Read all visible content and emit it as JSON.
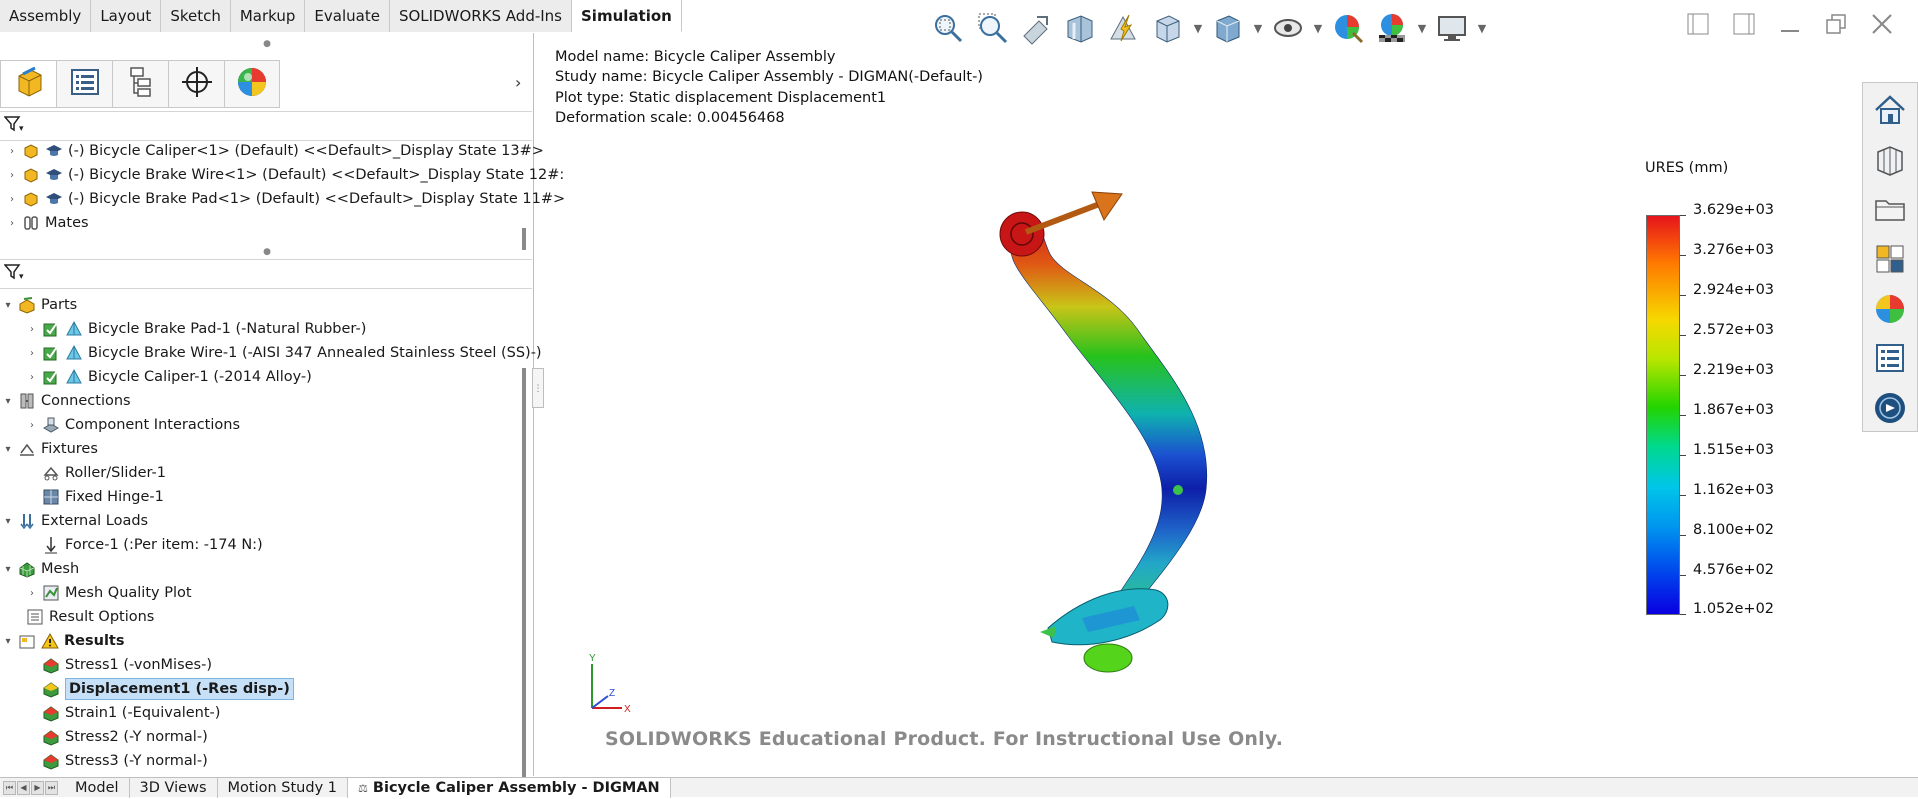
{
  "ribbon": {
    "tabs": [
      "Assembly",
      "Layout",
      "Sketch",
      "Markup",
      "Evaluate",
      "SOLIDWORKS Add-Ins",
      "Simulation"
    ],
    "active": "Simulation"
  },
  "hud_icons": [
    "zoom-to-fit-icon",
    "zoom-to-area-icon",
    "previous-view-icon",
    "section-view-icon",
    "dynamic-annotation-icon",
    "view-orientation-icon",
    "display-style-icon",
    "hide-show-items-icon",
    "edit-appearance-icon",
    "apply-scene-icon",
    "view-settings-icon"
  ],
  "feature_manager": {
    "tabs": [
      "featuremanager-icon",
      "propertymanager-icon",
      "configurationmanager-icon",
      "dimxpertmanager-icon",
      "displaymanager-icon"
    ],
    "tree": [
      {
        "label": "(-) Bicycle Caliper<1> (Default) <<Default>_Display State 13#>"
      },
      {
        "label": "(-) Bicycle Brake Wire<1> (Default) <<Default>_Display State 12#:"
      },
      {
        "label": "(-) Bicycle Brake Pad<1> (Default) <<Default>_Display State 11#>"
      },
      {
        "label": "Mates"
      }
    ]
  },
  "simulation_tree": {
    "parts_label": "Parts",
    "parts": [
      "Bicycle Brake Pad-1 (-Natural Rubber-)",
      "Bicycle Brake Wire-1 (-AISI 347 Annealed Stainless Steel (SS)-)",
      "Bicycle Caliper-1 (-2014 Alloy-)"
    ],
    "connections_label": "Connections",
    "connections": [
      "Component Interactions"
    ],
    "fixtures_label": "Fixtures",
    "fixtures": [
      "Roller/Slider-1",
      "Fixed Hinge-1"
    ],
    "loads_label": "External Loads",
    "loads": [
      "Force-1 (:Per item: -174 N:)"
    ],
    "mesh_label": "Mesh",
    "mesh": [
      "Mesh Quality Plot"
    ],
    "result_options": "Result Options",
    "results_label": "Results",
    "results": [
      "Stress1 (-vonMises-)",
      "Displacement1 (-Res disp-)",
      "Strain1 (-Equivalent-)",
      "Stress2 (-Y normal-)",
      "Stress3 (-Y normal-)"
    ],
    "selected_result": "Displacement1 (-Res disp-)"
  },
  "bottom_tabs": [
    "Model",
    "3D Views",
    "Motion Study 1",
    "Bicycle Caliper Assembly - DIGMAN"
  ],
  "graphics": {
    "info": [
      "Model name: Bicycle Caliper Assembly",
      "Study name: Bicycle Caliper Assembly - DIGMAN(-Default-)",
      "Plot type: Static displacement Displacement1",
      "Deformation scale: 0.00456468"
    ],
    "watermark": "SOLIDWORKS Educational Product. For Instructional Use Only.",
    "axis_labels": {
      "x": "X",
      "y": "Y",
      "z": "Z"
    }
  },
  "legend": {
    "title": "URES (mm)",
    "values": [
      "3.629e+03",
      "3.276e+03",
      "2.924e+03",
      "2.572e+03",
      "2.219e+03",
      "1.867e+03",
      "1.515e+03",
      "1.162e+03",
      "8.100e+02",
      "4.576e+02",
      "1.052e+02"
    ],
    "colors": {
      "max": "#e6141c",
      "mid": "#23d400",
      "min": "#0a00e0"
    }
  },
  "task_pane_icons": [
    "home-icon",
    "design-library-icon",
    "file-explorer-icon",
    "view-palette-icon",
    "appearances-icon",
    "custom-properties-icon",
    "solidworks-forum-icon"
  ]
}
